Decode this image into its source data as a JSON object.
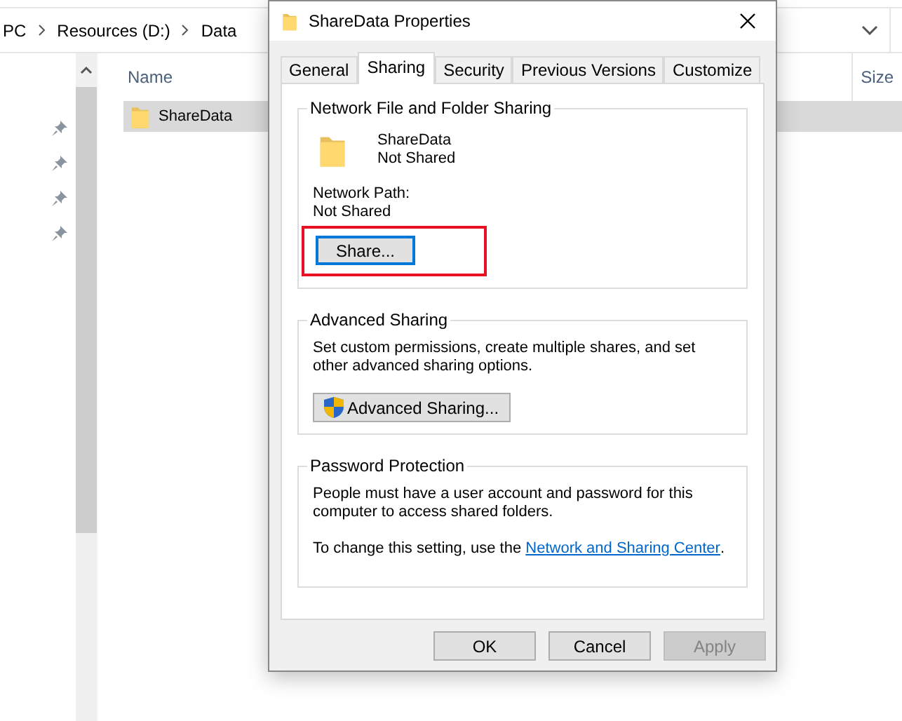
{
  "explorer": {
    "breadcrumb": [
      "PC",
      "Resources (D:)",
      "Data"
    ],
    "columns": [
      "Name",
      "Size"
    ],
    "rows": [
      {
        "name": "ShareData",
        "selected": true
      }
    ]
  },
  "dialog": {
    "title": "ShareData Properties",
    "tabs": [
      {
        "label": "General",
        "selected": false
      },
      {
        "label": "Sharing",
        "selected": true
      },
      {
        "label": "Security",
        "selected": false
      },
      {
        "label": "Previous Versions",
        "selected": false
      },
      {
        "label": "Customize",
        "selected": false
      }
    ],
    "network_sharing": {
      "title": "Network File and Folder Sharing",
      "folder_name": "ShareData",
      "status": "Not Shared",
      "path_label": "Network Path:",
      "path_value": "Not Shared",
      "share_button": {
        "label": "Share...",
        "highlighted": true
      }
    },
    "advanced_sharing": {
      "title": "Advanced Sharing",
      "description": "Set custom permissions, create multiple shares, and set other advanced sharing options.",
      "button": "Advanced Sharing..."
    },
    "password_protection": {
      "title": "Password Protection",
      "description": "People must have a user account and password for this computer to access shared folders.",
      "note": "To change this setting, use the",
      "link": "Network and Sharing Center",
      "note_end": "."
    },
    "buttons": [
      {
        "label": "OK",
        "disabled": false
      },
      {
        "label": "Cancel",
        "disabled": false
      },
      {
        "label": "Apply",
        "disabled": true
      }
    ]
  }
}
